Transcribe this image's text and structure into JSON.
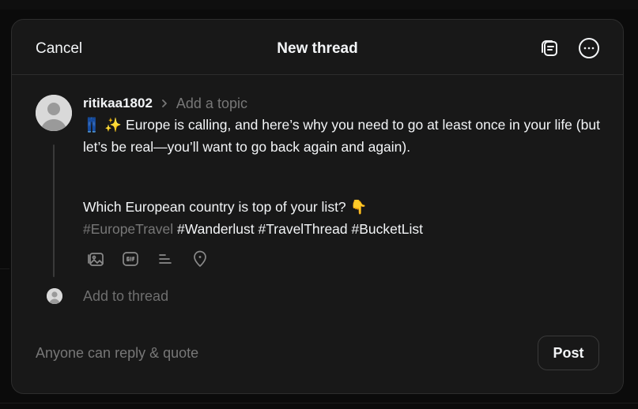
{
  "header": {
    "cancel_label": "Cancel",
    "title": "New thread",
    "icons": [
      "drafts-icon",
      "more-options-icon"
    ]
  },
  "post": {
    "username": "ritikaa1802",
    "topic_placeholder": "Add a topic",
    "line1_emojis": "👖 ✨",
    "line1_text": "Europe is calling, and here’s why you need to go at least once in your life (but let’s be real—you’ll want to go back again and again).",
    "line2_text": "Which European country is top of your list?",
    "line2_emoji": "👇",
    "hashtags": [
      "#EuropeTravel",
      "#Wanderlust",
      "#TravelThread",
      "#BucketList"
    ],
    "tools": [
      "image-icon",
      "gif-icon",
      "poll-icon",
      "location-icon"
    ]
  },
  "add_thread_placeholder": "Add to thread",
  "footer": {
    "reply_setting": "Anyone can reply & quote",
    "post_label": "Post"
  },
  "colors": {
    "modal_bg": "#181818",
    "text_primary": "#f3f5f7",
    "text_muted": "#777777",
    "border": "#2d2d2d"
  }
}
